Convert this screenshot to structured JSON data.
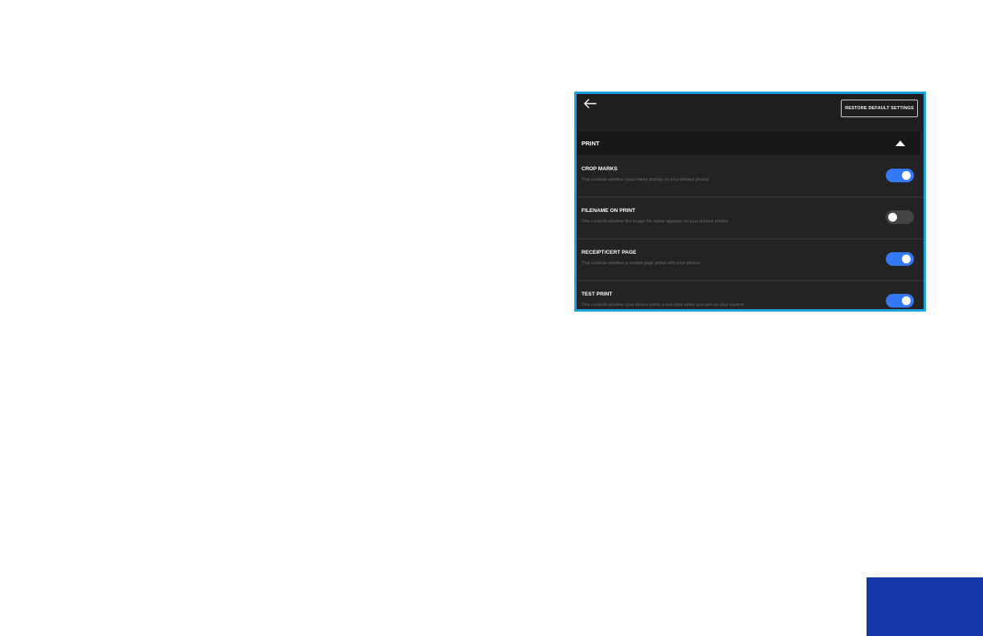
{
  "colors": {
    "frame_border": "#1aa3e0",
    "app_background": "#232323",
    "toggle_on": "#3478f6",
    "toggle_off": "#444444",
    "corner_block": "#1436a8"
  },
  "topbar": {
    "back_icon": "arrow-left-icon",
    "restore_label": "RESTORE DEFAULT SETTINGS"
  },
  "section": {
    "title": "PRINT",
    "collapse_icon": "triangle-up-icon",
    "expanded": true
  },
  "settings": [
    {
      "label": "CROP MARKS",
      "description": "This controls whether crop marks display on your printed photos",
      "enabled": true
    },
    {
      "label": "FILENAME ON PRINT",
      "description": "This controls whether the image file name appears on your printed photos",
      "enabled": false
    },
    {
      "label": "RECEIPT/CERT PAGE",
      "description": "This controls whether a receipt page prints with your photos",
      "enabled": true
    },
    {
      "label": "TEST PRINT",
      "description": "This controls whether your device prints a test print when you turn on your system",
      "enabled": true
    }
  ]
}
